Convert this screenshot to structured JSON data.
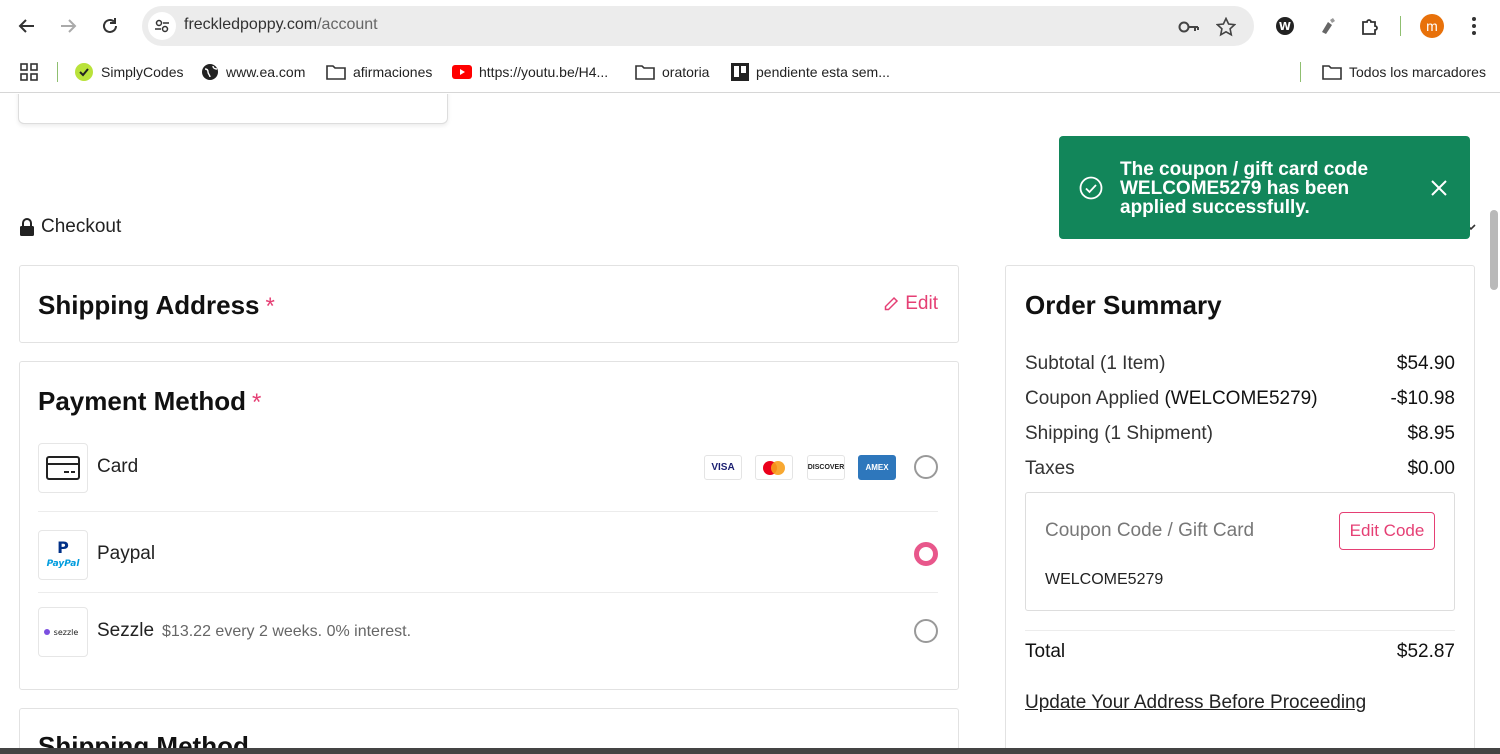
{
  "browser": {
    "url_domain": "freckledpoppy.com",
    "url_path": "/account",
    "profile_initial": "m",
    "bookmarks": [
      {
        "label": "SimplyCodes",
        "icon": "simplycodes-icon"
      },
      {
        "label": "www.ea.com",
        "icon": "globe-icon"
      },
      {
        "label": "afirmaciones",
        "icon": "folder-icon"
      },
      {
        "label": "https://youtu.be/H4...",
        "icon": "youtube-icon"
      },
      {
        "label": "oratoria",
        "icon": "folder-icon"
      },
      {
        "label": "pendiente esta sem...",
        "icon": "trello-icon"
      }
    ],
    "all_bookmarks_label": "Todos los marcadores"
  },
  "checkout": {
    "label": "Checkout"
  },
  "toast": {
    "message": "The coupon / gift card code WELCOME5279 has been applied successfully.",
    "color": "#12865a"
  },
  "shipping_address": {
    "title": "Shipping Address",
    "required": "*",
    "edit_label": "Edit"
  },
  "payment_method": {
    "title": "Payment Method",
    "required": "*",
    "options": [
      {
        "label": "Card",
        "selected": false,
        "logos": [
          "VISA",
          "MASTERCARD",
          "DISCOVER",
          "AMEX"
        ]
      },
      {
        "label": "Paypal",
        "selected": true
      },
      {
        "label": "Sezzle",
        "detail": "$13.22 every 2 weeks. 0% interest.",
        "selected": false
      }
    ]
  },
  "shipping_method": {
    "title": "Shipping Method"
  },
  "order_summary": {
    "title": "Order Summary",
    "rows": [
      {
        "label": "Subtotal (1 Item)",
        "value": "$54.90"
      },
      {
        "label": "Coupon Applied",
        "code": "(WELCOME5279)",
        "value": "-$10.98"
      },
      {
        "label": "Shipping (1 Shipment)",
        "value": "$8.95"
      },
      {
        "label": "Taxes",
        "value": "$0.00"
      }
    ],
    "coupon_placeholder": "Coupon Code / Gift Card",
    "coupon_button": "Edit Code",
    "coupon_code": "WELCOME5279",
    "total_label": "Total",
    "total_value": "$52.87",
    "update_link": "Update Your Address Before Proceeding"
  },
  "accent_color": "#e53f74"
}
